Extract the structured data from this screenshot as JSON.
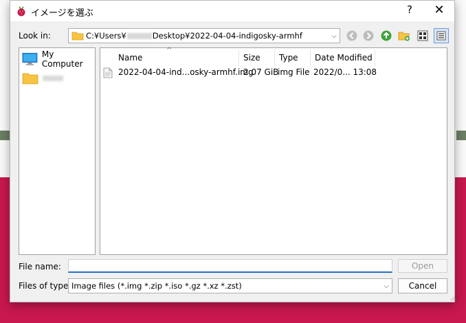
{
  "dialog": {
    "title": "イメージを選ぶ",
    "help_label": "?",
    "close_label": "✕"
  },
  "lookin": {
    "label": "Look in:",
    "path_prefix": "C:¥Users¥",
    "path_suffix": "Desktop¥2022-04-04-indigosky-armhf"
  },
  "places": {
    "items": [
      {
        "label": "My Computer",
        "icon": "computer-icon"
      },
      {
        "label": "",
        "icon": "folder-icon"
      }
    ]
  },
  "files": {
    "columns": [
      "Name",
      "Size",
      "Type",
      "Date Modified"
    ],
    "rows": [
      {
        "name": "2022-04-04-ind...osky-armhf.img",
        "size": "2.07 GiB",
        "type": "img File",
        "date": "2022/0... 13:08",
        "icon": "file-icon"
      }
    ]
  },
  "filename": {
    "label": "File name:",
    "value": "",
    "open_label": "Open"
  },
  "filetype": {
    "label": "Files of type:",
    "selected": "Image files (*.img *.zip *.iso *.gz *.xz *.zst)",
    "cancel_label": "Cancel"
  },
  "colors": {
    "accent": "#2a6dc6",
    "background_app_accent": "#c8184e",
    "folder": "#f6c342"
  }
}
